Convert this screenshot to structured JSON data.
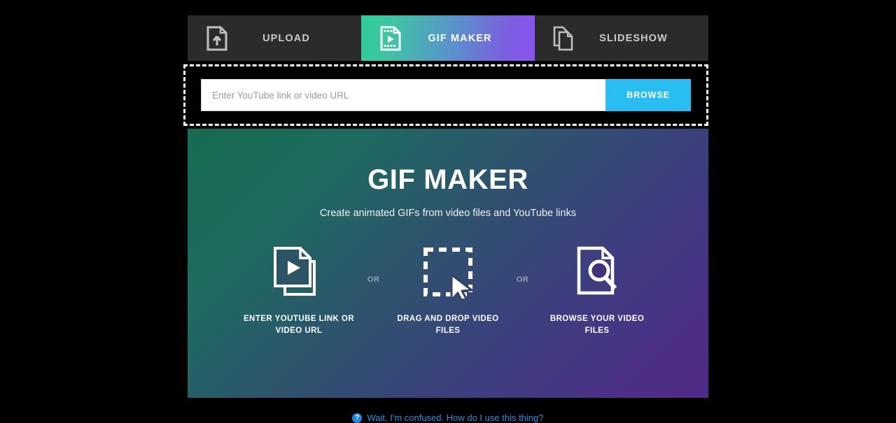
{
  "tabs": [
    {
      "id": "upload",
      "label": "UPLOAD",
      "icon": "document-upload-icon",
      "active": false
    },
    {
      "id": "gifmaker",
      "label": "GIF MAKER",
      "icon": "film-document-icon",
      "active": true
    },
    {
      "id": "slideshow",
      "label": "SLIDESHOW",
      "icon": "stacked-documents-icon",
      "active": false
    }
  ],
  "url_bar": {
    "placeholder": "Enter YouTube link or video URL",
    "value": "",
    "browse_label": "BROWSE",
    "browse_color": "#29bdf2"
  },
  "hero": {
    "title": "GIF MAKER",
    "subtitle": "Create animated GIFs from video files and YouTube links",
    "gradient_start": "#166b52",
    "gradient_end": "#4f2b86",
    "separator": "OR",
    "options": [
      {
        "icon": "video-play-stack-icon",
        "label": "ENTER YOUTUBE LINK OR VIDEO URL"
      },
      {
        "icon": "drag-drop-cursor-icon",
        "label": "DRAG AND DROP VIDEO FILES"
      },
      {
        "icon": "document-search-icon",
        "label": "BROWSE YOUR VIDEO FILES"
      }
    ]
  },
  "footer": {
    "help_icon": "question-mark-icon",
    "help_text": "Wait, I'm confused. How do I use this thing?",
    "help_color": "#2e8fe0"
  }
}
